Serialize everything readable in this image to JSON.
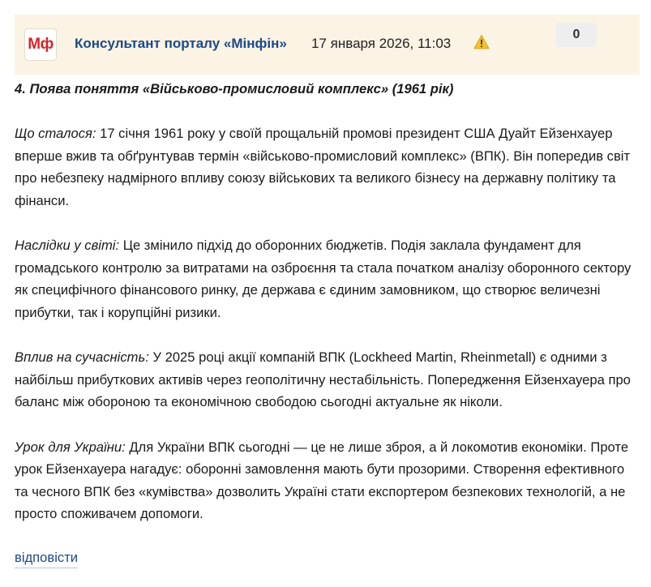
{
  "post": {
    "logo_text": "Мф",
    "author": "Консультант порталу «Мінфін»",
    "date": "17 января 2026, 11:03",
    "warning_icon": "warning-icon",
    "likes": "0",
    "heading": "4. Поява поняття «Військово-промисловий комплекс» (1961 рік)",
    "paragraphs": [
      {
        "lead": "Що сталося:",
        "text": " 17 січня 1961 року у своїй прощальній промові президент США Дуайт Ейзенхауер вперше вжив та обґрунтував термін «військово-промисловий комплекс» (ВПК). Він попередив світ про небезпеку надмірного впливу союзу військових та великого бізнесу на державну політику та фінанси."
      },
      {
        "lead": "Наслідки у світі:",
        "text": " Це змінило підхід до оборонних бюджетів. Подія заклала фундамент для громадського контролю за витратами на озброєння та стала початком аналізу оборонного сектору як специфічного фінансового ринку, де держава є єдиним замовником, що створює величезні прибутки, так і корупційні ризики."
      },
      {
        "lead": "Вплив на сучасність:",
        "text": " У 2025 році акції компаній ВПК (Lockheed Martin, Rheinmetall) є одними з найбільш прибуткових активів через геополітичну нестабільність. Попередження Ейзенхауера про баланс між обороною та економічною свободою сьогодні актуальне як ніколи."
      },
      {
        "lead": "Урок для України:",
        "text": " Для України ВПК сьогодні — це не лише зброя, а й локомотив економіки. Проте урок Ейзенхауера нагадує: оборонні замовлення мають бути прозорими. Створення ефективного та чесного ВПК без «кумівства» дозволить Україні стати експортером безпекових технологій, а не просто споживачем допомоги."
      }
    ],
    "reply_label": "відповісти"
  }
}
